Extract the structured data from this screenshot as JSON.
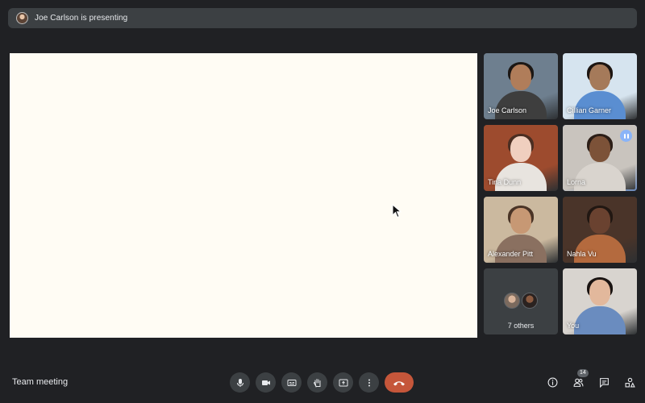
{
  "banner": {
    "text": "Joe Carlson is presenting",
    "icon": "presenter-avatar-icon"
  },
  "participants": [
    {
      "name": "Joe Carlson",
      "bg": "#6e7f8f",
      "skin": "#b07d5a",
      "hair": "#1c1714",
      "shirt": "#3e3e3e",
      "speaking": false
    },
    {
      "name": "Cillian Garner",
      "bg": "#d6e4ef",
      "skin": "#a57a5a",
      "hair": "#1d1511",
      "shirt": "#5a8ed1",
      "speaking": false
    },
    {
      "name": "Tina Dunn",
      "bg": "#9d4b2e",
      "skin": "#f0cfbf",
      "hair": "#4b2e22",
      "shirt": "#e8e4df",
      "speaking": false
    },
    {
      "name": "Lorna",
      "bg": "#c9c4be",
      "skin": "#7c5238",
      "hair": "#2c1e17",
      "shirt": "#d9d4ce",
      "speaking": true
    },
    {
      "name": "Alexander Pitt",
      "bg": "#cbb99f",
      "skin": "#c79874",
      "hair": "#4a3426",
      "shirt": "#8a7060",
      "speaking": false
    },
    {
      "name": "Nahla Vu",
      "bg": "#4a3429",
      "skin": "#6a4230",
      "hair": "#211712",
      "shirt": "#b46a3e",
      "speaking": false
    },
    {
      "name": "You",
      "bg": "#d8d4cf",
      "skin": "#e2b89c",
      "hair": "#1a1412",
      "shirt": "#6a8cbf",
      "speaking": false
    }
  ],
  "others": {
    "label": "7 others"
  },
  "meeting": {
    "title": "Team meeting"
  },
  "controls": {
    "items": [
      "microphone-icon",
      "camera-icon",
      "captions-icon",
      "raise-hand-icon",
      "present-screen-icon",
      "more-options-icon"
    ],
    "end_call_icon": "end-call-icon",
    "end_call_color": "#c5563a"
  },
  "right": {
    "people_count": "14",
    "icons": [
      "info-icon",
      "people-icon",
      "chat-icon",
      "activities-icon"
    ]
  }
}
